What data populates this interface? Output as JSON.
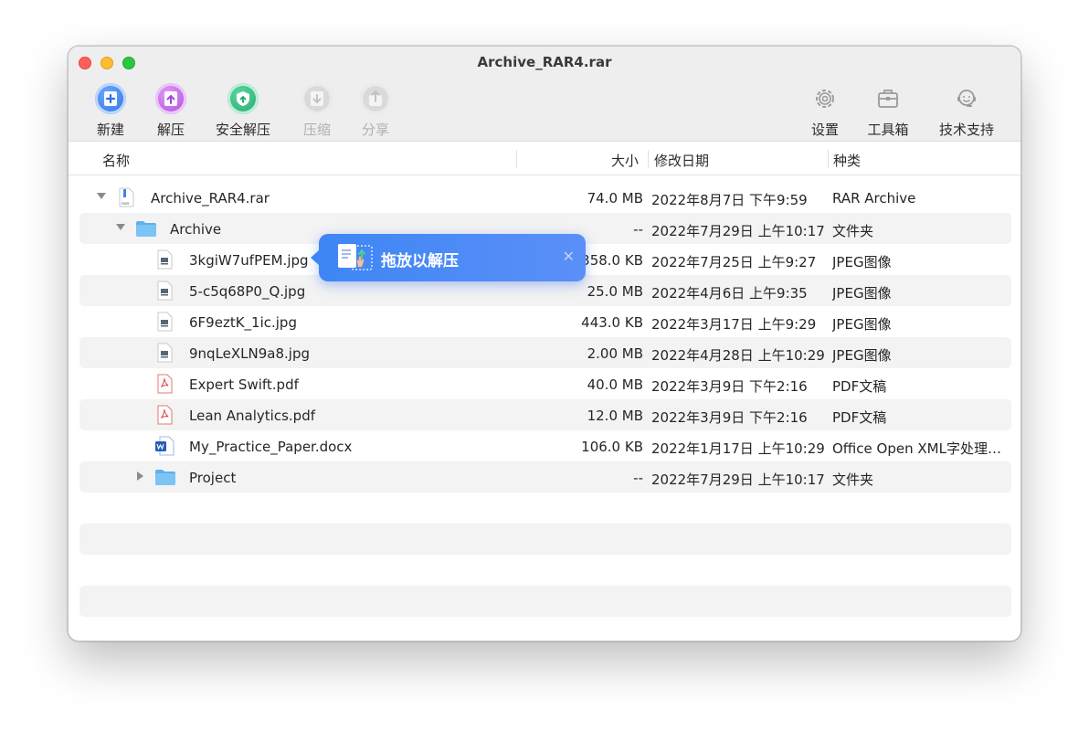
{
  "window": {
    "title": "Archive_RAR4.rar"
  },
  "toolbar": {
    "new": "新建",
    "extract": "解压",
    "safe_extract": "安全解压",
    "compress": "压缩",
    "share": "分享",
    "settings": "设置",
    "toolbox": "工具箱",
    "support": "技术支持"
  },
  "columns": {
    "name": "名称",
    "size": "大小",
    "date": "修改日期",
    "kind": "种类"
  },
  "tooltip": {
    "text": "拖放以解压"
  },
  "rows": [
    {
      "name": "Archive_RAR4.rar",
      "size": "74.0 MB",
      "date": "2022年8月7日 下午9:59",
      "kind": "RAR Archive"
    },
    {
      "name": "Archive",
      "size": "--",
      "date": "2022年7月29日 上午10:17",
      "kind": "文件夹"
    },
    {
      "name": "3kgiW7ufPEM.jpg",
      "size": "358.0 KB",
      "date": "2022年7月25日 上午9:27",
      "kind": "JPEG图像"
    },
    {
      "name": "5-c5q68P0_Q.jpg",
      "size": "25.0 MB",
      "date": "2022年4月6日 上午9:35",
      "kind": "JPEG图像"
    },
    {
      "name": "6F9eztK_1ic.jpg",
      "size": "443.0 KB",
      "date": "2022年3月17日 上午9:29",
      "kind": "JPEG图像"
    },
    {
      "name": "9nqLeXLN9a8.jpg",
      "size": "2.00 MB",
      "date": "2022年4月28日 上午10:29",
      "kind": "JPEG图像"
    },
    {
      "name": "Expert Swift.pdf",
      "size": "40.0 MB",
      "date": "2022年3月9日 下午2:16",
      "kind": "PDF文稿"
    },
    {
      "name": "Lean Analytics.pdf",
      "size": "12.0 MB",
      "date": "2022年3月9日 下午2:16",
      "kind": "PDF文稿"
    },
    {
      "name": "My_Practice_Paper.docx",
      "size": "106.0 KB",
      "date": "2022年1月17日 上午10:29",
      "kind": "Office Open XML字处理…"
    },
    {
      "name": "Project",
      "size": "--",
      "date": "2022年7月29日 上午10:17",
      "kind": "文件夹"
    }
  ]
}
